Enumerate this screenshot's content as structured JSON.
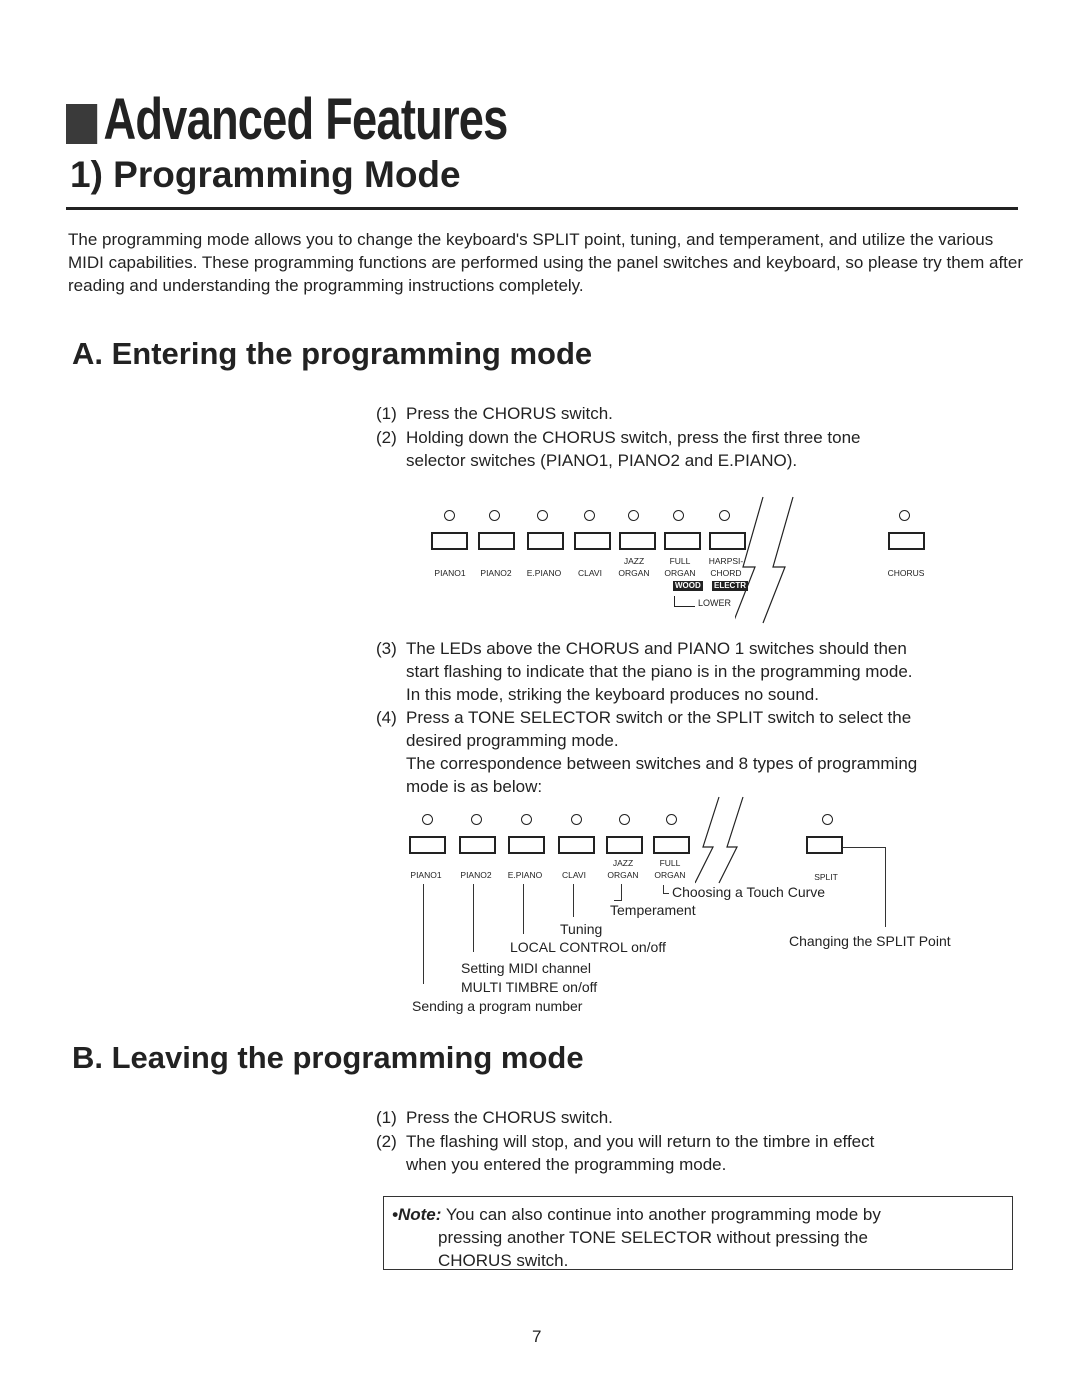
{
  "header": {
    "title": "Advanced Features",
    "subtitle": "1) Programming Mode"
  },
  "intro": "The programming mode allows you to change the keyboard's SPLIT point, tuning, and temperament, and utilize the various MIDI capabilities.  These programming functions are performed using the panel switches and keyboard, so please try them after reading and understanding the programming instructions completely.",
  "section_a": {
    "heading": "A. Entering the programming mode",
    "steps": [
      {
        "num": "(1)",
        "lines": [
          "Press the CHORUS switch."
        ]
      },
      {
        "num": "(2)",
        "lines": [
          "Holding down the CHORUS switch, press the first three tone",
          "selector switches (PIANO1, PIANO2 and E.PIANO)."
        ]
      },
      {
        "num": "(3)",
        "lines": [
          "The LEDs above the CHORUS and PIANO 1 switches should then",
          "start flashing to indicate that the piano is in the programming mode.",
          "In this mode, striking the keyboard produces no sound."
        ]
      },
      {
        "num": "(4)",
        "lines": [
          "Press a TONE SELECTOR switch or the SPLIT switch to select the",
          "desired programming mode.",
          "The correspondence between switches and 8 types of programming",
          "mode is as below:"
        ]
      }
    ],
    "panel1": {
      "switches": [
        {
          "top": "",
          "bottom": "PIANO1"
        },
        {
          "top": "",
          "bottom": "PIANO2"
        },
        {
          "top": "",
          "bottom": "E.PIANO"
        },
        {
          "top": "",
          "bottom": "CLAVI"
        },
        {
          "top": "JAZZ",
          "bottom": "ORGAN"
        },
        {
          "top": "FULL",
          "bottom": "ORGAN"
        },
        {
          "top": "HARPSI-",
          "bottom": "CHORD"
        }
      ],
      "tags": [
        "WOOD",
        "ELECTR"
      ],
      "lower_label": "LOWER",
      "chorus_label": "CHORUS"
    },
    "panel2": {
      "switches": [
        {
          "top": "",
          "bottom": "PIANO1"
        },
        {
          "top": "",
          "bottom": "PIANO2"
        },
        {
          "top": "",
          "bottom": "E.PIANO"
        },
        {
          "top": "",
          "bottom": "CLAVI"
        },
        {
          "top": "JAZZ",
          "bottom": "ORGAN"
        },
        {
          "top": "FULL",
          "bottom": "ORGAN"
        }
      ],
      "split_label": "SPLIT",
      "callouts": {
        "touch_curve": "Choosing a Touch Curve",
        "temperament": "Temperament",
        "tuning": "Tuning",
        "local_control": "LOCAL CONTROL on/off",
        "midi_channel": "Setting MIDI channel",
        "multi_timbre": "MULTI TIMBRE on/off",
        "program_number": "Sending a program number",
        "split_point": "Changing the SPLIT Point"
      }
    }
  },
  "section_b": {
    "heading": "B. Leaving the programming mode",
    "steps": [
      {
        "num": "(1)",
        "lines": [
          "Press the CHORUS switch."
        ]
      },
      {
        "num": "(2)",
        "lines": [
          "The flashing will stop, and you will return to the timbre in effect",
          "when you entered the programming mode."
        ]
      }
    ]
  },
  "note": {
    "label": "•Note:",
    "lines": [
      "You can also continue into another programming mode by",
      "pressing another TONE SELECTOR without pressing the",
      "CHORUS switch."
    ]
  },
  "page_number": "7"
}
